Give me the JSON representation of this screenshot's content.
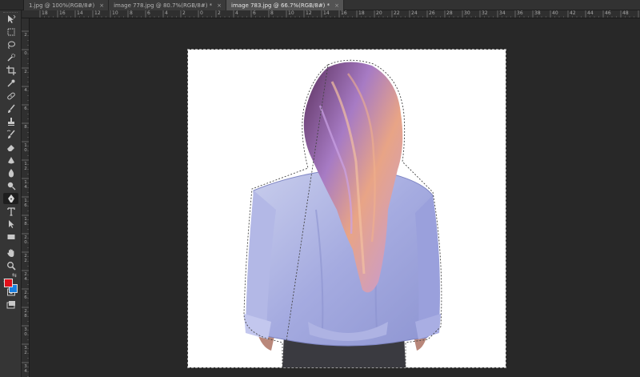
{
  "tabs": [
    {
      "label": "1.jpg @ 100%(RGB/8#)",
      "close": "×",
      "active": false
    },
    {
      "label": "image 778.jpg @ 80.7%(RGB/8#) *",
      "close": "×",
      "active": false
    },
    {
      "label": "image 783.jpg @ 66.7%(RGB/8#) *",
      "close": "×",
      "active": true
    }
  ],
  "ruler_top_labels": [
    "18",
    "16",
    "14",
    "12",
    "10",
    "8",
    "6",
    "4",
    "2",
    "0",
    "2",
    "4",
    "6",
    "8",
    "10",
    "12",
    "14",
    "16",
    "18",
    "20",
    "22",
    "24",
    "26",
    "28",
    "30",
    "32",
    "34",
    "36",
    "38",
    "40",
    "42",
    "44",
    "46",
    "48",
    "50"
  ],
  "ruler_left_labels": [
    "2",
    "0",
    "2",
    "4",
    "6",
    "8",
    "1 0",
    "1 2",
    "1 4",
    "1 6",
    "1 8",
    "2 0",
    "2 2",
    "2 4",
    "2 6",
    "2 8",
    "3 0",
    "3 2",
    "3 4"
  ],
  "colors": {
    "foreground": "#e0101a",
    "background": "#1a7fe0",
    "swap_glyph": "⇆"
  },
  "tools": [
    "move-icon",
    "marquee-icon",
    "lasso-icon",
    "quick-select-icon",
    "crop-icon",
    "eyedropper-icon",
    "healing-icon",
    "brush-icon",
    "clone-stamp-icon",
    "history-brush-icon",
    "eraser-icon",
    "gradient-icon",
    "blur-icon",
    "dodge-icon",
    "pen-icon",
    "type-icon",
    "path-select-icon",
    "rectangle-icon",
    "hand-icon",
    "zoom-icon",
    "quick-mask-icon",
    "screen-mode-icon"
  ]
}
